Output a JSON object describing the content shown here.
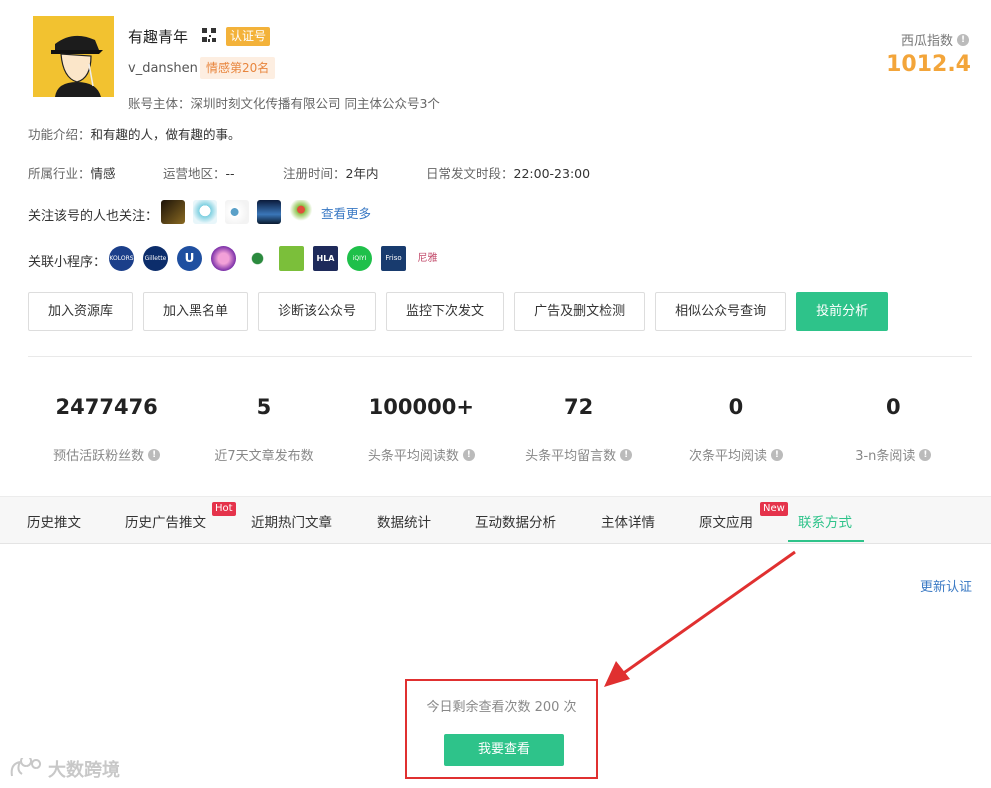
{
  "profile": {
    "name": "有趣青年",
    "cert_badge": "认证号",
    "wechat_id": "v_danshen",
    "rank_badge": "情感第20名",
    "owner": "账号主体：深圳时刻文化传播有限公司 同主体公众号3个",
    "xigua_label": "西瓜指数",
    "xigua_value": "1012.4",
    "colors": {
      "accent": "#2ec38a",
      "orange": "#f3a53a",
      "link": "#3a79c4"
    }
  },
  "intro": {
    "label": "功能介绍：",
    "value": "和有趣的人，做有趣的事。"
  },
  "meta": [
    {
      "label": "所属行业：",
      "value": "情感"
    },
    {
      "label": "运营地区：",
      "value": "--"
    },
    {
      "label": "注册时间：",
      "value": "2年内"
    },
    {
      "label": "日常发文时段：",
      "value": "22:00-23:00"
    }
  ],
  "followers_also": {
    "label": "关注该号的人也关注：",
    "more": "查看更多"
  },
  "mini_programs": {
    "label": "关联小程序："
  },
  "actions": [
    "加入资源库",
    "加入黑名单",
    "诊断该公众号",
    "监控下次发文",
    "广告及删文检测",
    "相似公众号查询",
    "投前分析"
  ],
  "stats": [
    {
      "value": "2477476",
      "label": "预估活跃粉丝数"
    },
    {
      "value": "5",
      "label": "近7天文章发布数"
    },
    {
      "value": "100000+",
      "label": "头条平均阅读数"
    },
    {
      "value": "72",
      "label": "头条平均留言数"
    },
    {
      "value": "0",
      "label": "次条平均阅读"
    },
    {
      "value": "0",
      "label": "3-n条阅读"
    }
  ],
  "tabs": [
    {
      "label": "历史推文"
    },
    {
      "label": "历史广告推文",
      "tag": "Hot"
    },
    {
      "label": "近期热门文章"
    },
    {
      "label": "数据统计"
    },
    {
      "label": "互动数据分析"
    },
    {
      "label": "主体详情"
    },
    {
      "label": "原文应用",
      "tag": "New"
    },
    {
      "label": "联系方式"
    }
  ],
  "contact": {
    "renew_link": "更新认证",
    "remaining": "今日剩余查看次数 200 次",
    "view_button": "我要查看"
  },
  "watermark": "大数跨境",
  "mini_labels": [
    "KOLORS",
    "Gillette",
    "U",
    "HLA",
    "iQIYI",
    "Friso",
    "尼雅"
  ]
}
